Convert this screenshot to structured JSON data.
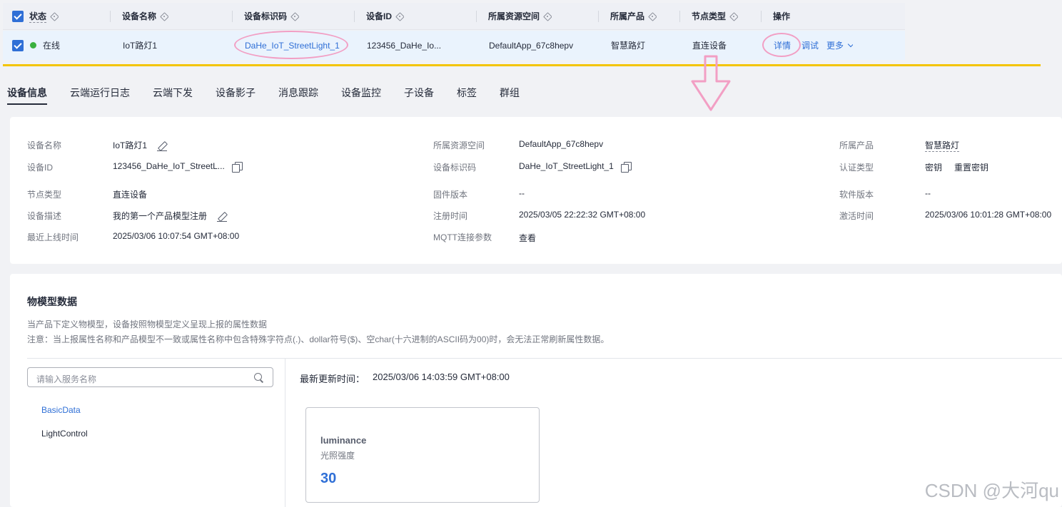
{
  "table": {
    "headers": [
      "状态",
      "设备名称",
      "设备标识码",
      "设备ID",
      "所属资源空间",
      "所属产品",
      "节点类型",
      "操作"
    ],
    "row": {
      "status": "在线",
      "name": "IoT路灯1",
      "identifier": "DaHe_IoT_StreetLight_1",
      "device_id": "123456_DaHe_Io...",
      "space": "DefaultApp_67c8hepv",
      "product": "智慧路灯",
      "node_type": "直连设备",
      "actions": {
        "detail": "详情",
        "debug": "调试",
        "more": "更多"
      }
    }
  },
  "tabs": [
    "设备信息",
    "云端运行日志",
    "云端下发",
    "设备影子",
    "消息跟踪",
    "设备监控",
    "子设备",
    "标签",
    "群组"
  ],
  "info": {
    "device_name_label": "设备名称",
    "device_name": "IoT路灯1",
    "device_id_label": "设备ID",
    "device_id": "123456_DaHe_IoT_StreetL...",
    "node_type_label": "节点类型",
    "node_type": "直连设备",
    "desc_label": "设备描述",
    "desc": "我的第一个产品模型注册",
    "last_online_label": "最近上线时间",
    "last_online": "2025/03/06 10:07:54 GMT+08:00",
    "space_label": "所属资源空间",
    "space": "DefaultApp_67c8hepv",
    "identifier_label": "设备标识码",
    "identifier": "DaHe_IoT_StreetLight_1",
    "firmware_label": "固件版本",
    "firmware": "--",
    "register_label": "注册时间",
    "register": "2025/03/05 22:22:32 GMT+08:00",
    "mqtt_label": "MQTT连接参数",
    "mqtt_link": "查看",
    "product_label": "所属产品",
    "product": "智慧路灯",
    "auth_label": "认证类型",
    "auth": "密钥",
    "reset_key": "重置密钥",
    "software_label": "软件版本",
    "software": "--",
    "activate_label": "激活时间",
    "activate": "2025/03/06 10:01:28 GMT+08:00"
  },
  "model": {
    "title": "物模型数据",
    "hint1": "当产品下定义物模型，设备按照物模型定义呈现上报的属性数据",
    "hint2": "注意：当上报属性名称和产品模型不一致或属性名称中包含特殊字符点(.)、dollar符号($)、空char(十六进制的ASCII码为00)时，会无法正常刷新属性数据。",
    "search_placeholder": "请输入服务名称",
    "services": [
      "BasicData",
      "LightControl"
    ],
    "update_label": "最新更新时间：",
    "update_time": "2025/03/06 14:03:59 GMT+08:00",
    "property": {
      "name": "luminance",
      "label": "光照强度",
      "value": "30"
    }
  },
  "watermark": "CSDN @大河qu",
  "colors": {
    "link": "#2f6fd6",
    "online": "#3ab03e",
    "annotation_pink": "#f29fc4",
    "annotation_yellow": "#f4c400"
  }
}
